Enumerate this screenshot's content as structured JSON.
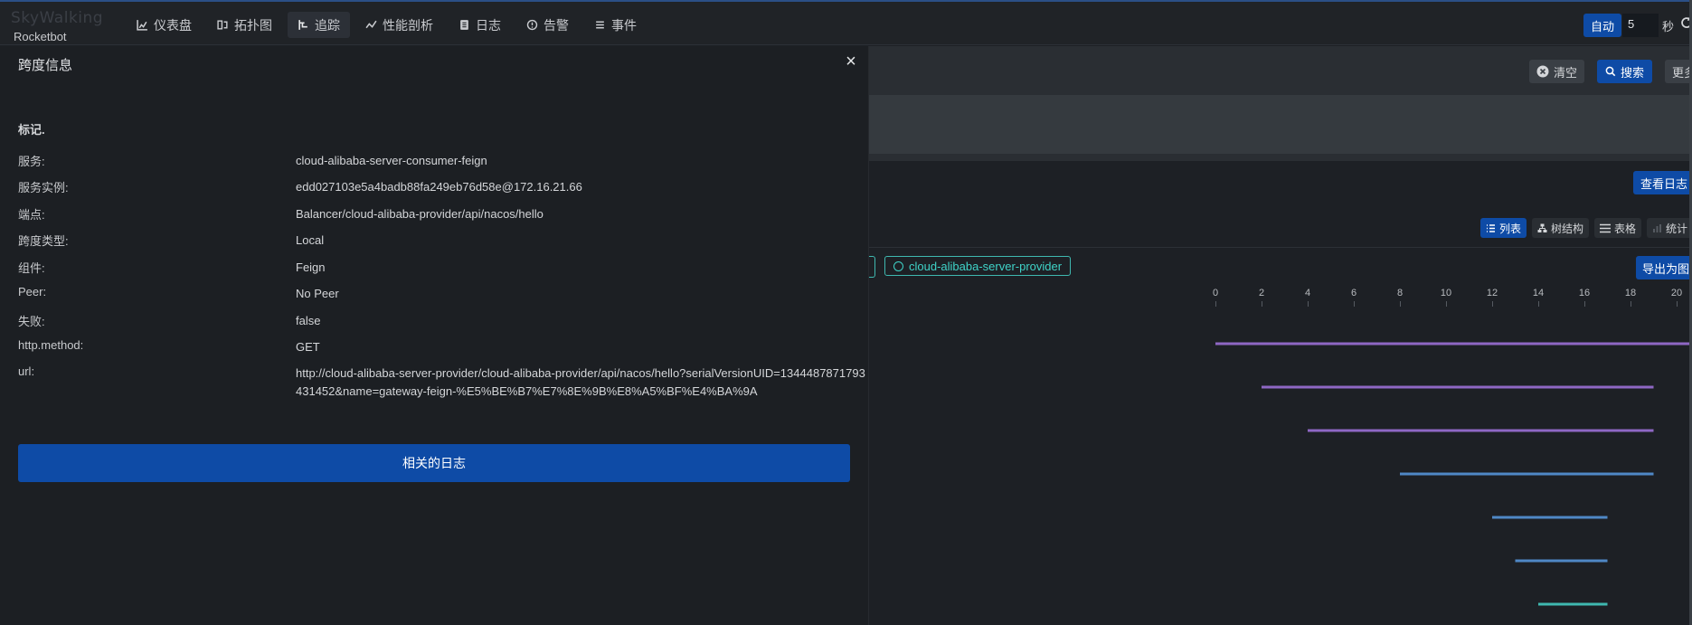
{
  "app": {
    "logo_mark": "SkyWalking",
    "logo_text": "Rocketbot"
  },
  "nav": {
    "items": [
      {
        "label": "仪表盘",
        "icon": "dashboard-icon"
      },
      {
        "label": "拓扑图",
        "icon": "topology-icon"
      },
      {
        "label": "追踪",
        "icon": "trace-icon"
      },
      {
        "label": "性能剖析",
        "icon": "profile-icon"
      },
      {
        "label": "日志",
        "icon": "log-icon"
      },
      {
        "label": "告警",
        "icon": "alarm-icon"
      },
      {
        "label": "事件",
        "icon": "event-icon"
      }
    ],
    "active_index": 2,
    "auto_label": "自动",
    "auto_interval": "5",
    "seconds_label": "秒"
  },
  "trace_toolbar": {
    "clear_label": "清空",
    "search_label": "搜索",
    "more_label": "更多",
    "view_log_label": "查看日志",
    "view_tabs": [
      "列表",
      "树结构",
      "表格",
      "统计"
    ],
    "export_label": "导出为图片",
    "service_tag": "cloud-alibaba-server-provider"
  },
  "timeline": {
    "ticks": [
      "0",
      "2",
      "4",
      "6",
      "8",
      "10",
      "12",
      "14",
      "16",
      "18",
      "20"
    ],
    "spans": [
      {
        "start": 0,
        "end": 21,
        "color": "#8e67c4"
      },
      {
        "start": 2,
        "end": 19,
        "color": "#8e67c4"
      },
      {
        "start": 4,
        "end": 19,
        "color": "#8e67c4"
      },
      {
        "start": 8,
        "end": 19,
        "color": "#4f88c6"
      },
      {
        "start": 12,
        "end": 17,
        "color": "#4f88c6"
      },
      {
        "start": 13,
        "end": 17,
        "color": "#4f88c6"
      },
      {
        "start": 14,
        "end": 17,
        "color": "#3fb8b0"
      }
    ]
  },
  "drawer": {
    "title": "跨度信息",
    "tags_heading": "标记.",
    "rows": [
      {
        "key": "服务:",
        "value": "cloud-alibaba-server-consumer-feign"
      },
      {
        "key": "服务实例:",
        "value": "edd027103e5a4badb88fa249eb76d58e@172.16.21.66"
      },
      {
        "key": "端点:",
        "value": "Balancer/cloud-alibaba-provider/api/nacos/hello"
      },
      {
        "key": "跨度类型:",
        "value": "Local"
      },
      {
        "key": "组件:",
        "value": "Feign"
      },
      {
        "key": "Peer:",
        "value": "No Peer"
      },
      {
        "key": "失败:",
        "value": "false"
      },
      {
        "key": "http.method:",
        "value": "GET"
      },
      {
        "key": "url:",
        "value": "http://cloud-alibaba-server-provider/cloud-alibaba-provider/api/nacos/hello?serialVersionUID=1344487871793431452&name=gateway-feign-%E5%BE%B7%E7%8E%9B%E8%A5%BF%E4%BA%9A"
      }
    ],
    "related_log_label": "相关的日志"
  }
}
